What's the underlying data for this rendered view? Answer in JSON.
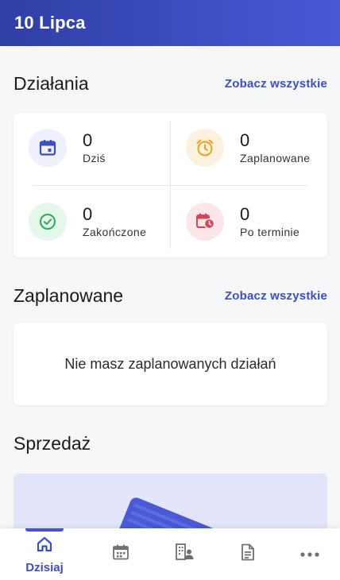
{
  "appbar": {
    "title": "10 Lipca"
  },
  "activities": {
    "title": "Działania",
    "see_all": "Zobacz wszystkie",
    "stats": [
      {
        "label": "Dziś",
        "value": "0",
        "icon": "calendar-icon",
        "color": "#3d4dc3"
      },
      {
        "label": "Zaplanowane",
        "value": "0",
        "icon": "alarm-clock-icon",
        "color": "#e8a21c"
      },
      {
        "label": "Zakończone",
        "value": "0",
        "icon": "check-circle-icon",
        "color": "#2fa85a"
      },
      {
        "label": "Po terminie",
        "value": "0",
        "icon": "overdue-calendar-icon",
        "color": "#d9435a"
      }
    ]
  },
  "scheduled": {
    "title": "Zaplanowane",
    "see_all": "Zobacz wszystkie",
    "empty_message": "Nie masz zaplanowanych działań"
  },
  "sales": {
    "title": "Sprzedaż"
  },
  "bottom_nav": {
    "items": [
      {
        "label": "Dzisiaj",
        "icon": "home-icon",
        "active": true
      },
      {
        "label": "",
        "icon": "calendar-icon",
        "active": false
      },
      {
        "label": "",
        "icon": "contacts-icon",
        "active": false
      },
      {
        "label": "",
        "icon": "document-icon",
        "active": false
      },
      {
        "label": "",
        "icon": "more-icon",
        "active": false
      }
    ]
  }
}
